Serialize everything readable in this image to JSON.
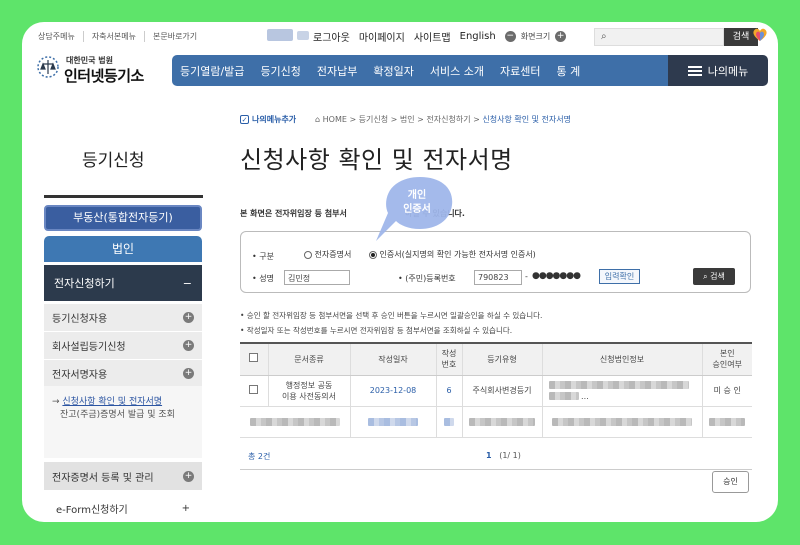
{
  "util_links": [
    "상담주메뉴",
    "자축서본메뉴",
    "본문바로가기"
  ],
  "top_menu": {
    "logout": "로그아웃",
    "mypage": "마이페이지",
    "sitemap": "사이트맵",
    "english": "English",
    "fontsize": "화면크기",
    "minus": "−",
    "plus": "+"
  },
  "search": {
    "placeholder": "",
    "button": "검색"
  },
  "logo": {
    "small": "대한민국 법원",
    "big": "인터넷등기소"
  },
  "gnb": [
    "등기열람/발급",
    "등기신청",
    "전자납부",
    "확정일자",
    "서비스 소개",
    "자료센터",
    "통 계"
  ],
  "my_menu": "나의메뉴",
  "sidebar": {
    "title": "등기신청",
    "realestate": "부동산(통합전자등기)",
    "corp": "법인",
    "electronic": "전자신청하기",
    "minus": "−",
    "items": [
      "등기신청자용",
      "회사설립등기신청",
      "전자서명자용"
    ],
    "sub_active": "신청사항 확인 및 전자서명",
    "sub_other": "잔고(주금)증명서 발급 및 조회",
    "cert": "전자증명서 등록 및 관리",
    "eform": "e-Form신청하기",
    "plus": "+"
  },
  "breadcrumb": {
    "fav": "나의메뉴추가",
    "path": "HOME > 등기신청 > 법인 > 전자신청하기 > ",
    "current": "신청사항 확인 및 전자서명"
  },
  "page_title": "신청사항 확인 및 전자서명",
  "intro": "본 화면은 전자위임장 등 첨부서",
  "intro_tail": "하실 수 있습니다.",
  "bubble": {
    "line1": "개인",
    "line2": "인증서"
  },
  "form": {
    "type_label": "• 구분",
    "opt1": "전자증명서",
    "opt2": "인증서(실지명의 확인 가능한 전자서명 인증서)",
    "name_label": "• 성명",
    "name_value": "김민정",
    "rrn_label": "• (주민)등록번호",
    "rrn_front": "790823",
    "rrn_back": "●●●●●●●",
    "dash": "-",
    "confirm_btn": "입력확인",
    "search_btn": "검색"
  },
  "notes": [
    "• 승인 할 전자위임장 등 첨부서면을 선택 후 승인 버튼을 누르시면 일괄승인을 하실 수 있습니다.",
    "• 작성일자 또는 작성번호를 누르시면 전자위임장 등 첨부서면을 조회하실 수 있습니다."
  ],
  "table": {
    "headers": [
      "문서종류",
      "작성일자",
      "작성\n번호",
      "등기유형",
      "신청법인정보",
      "본인\n승인여부"
    ],
    "row1": {
      "doc": "행정정보 공동\n이용 사전동의서",
      "date": "2023-12-08",
      "num": "6",
      "type": "주식회사변경등기",
      "corp_tail": "...",
      "approval": "미 승 인"
    }
  },
  "footer": {
    "total": "총 2건",
    "page": "1",
    "page_total": "(1/ 1)",
    "approve": "승인"
  }
}
